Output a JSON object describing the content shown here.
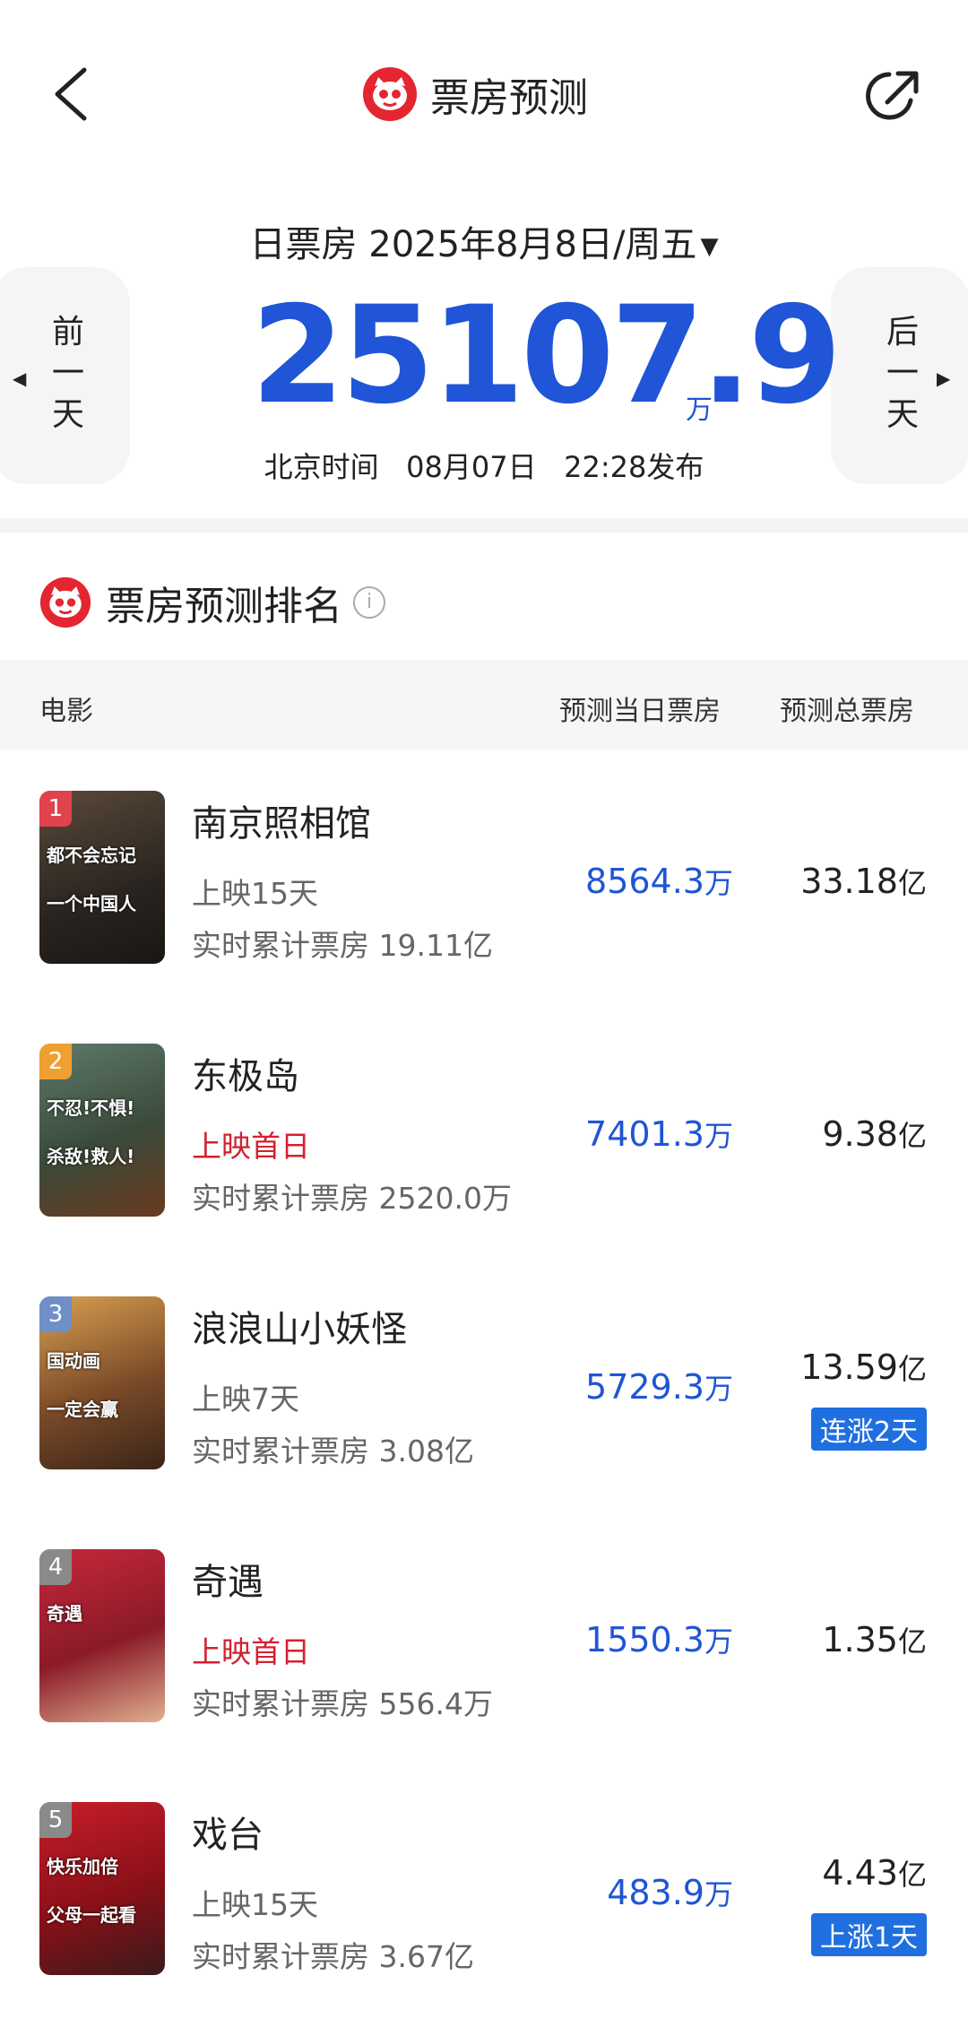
{
  "header": {
    "title": "票房预测"
  },
  "date_selector": {
    "type": "日票房",
    "date": "2025年8月8日/周五"
  },
  "nav": {
    "prev_label": "前一天",
    "next_label": "后一天"
  },
  "total": {
    "value": "25107.9",
    "unit": "万"
  },
  "publish_info": {
    "label": "北京时间",
    "date": "08月07日",
    "time": "22:28发布"
  },
  "section": {
    "title": "票房预测排名"
  },
  "columns": {
    "movie": "电影",
    "daily": "预测当日票房",
    "total": "预测总票房"
  },
  "colors": {
    "accent": "#1f55d6",
    "brand_red": "#e3262f",
    "first_day_red": "#d42030",
    "badge_blue": "#1f6fe0"
  },
  "movies": [
    {
      "rank": "1",
      "title": "南京照相馆",
      "days": "上映15天",
      "cumulative": "实时累计票房 19.11亿",
      "daily": "8564.3",
      "daily_unit": "万",
      "total": "33.18",
      "total_unit": "亿",
      "badge": "",
      "rank_color": "#e0434b",
      "poster_text": [
        "都不会忘记",
        "一个中国人"
      ]
    },
    {
      "rank": "2",
      "title": "东极岛",
      "days": "上映首日",
      "cumulative": "实时累计票房 2520.0万",
      "daily": "7401.3",
      "daily_unit": "万",
      "total": "9.38",
      "total_unit": "亿",
      "badge": "",
      "rank_color": "#f0a030",
      "poster_text": [
        "不忍!不惧!",
        "杀敌!救人!"
      ]
    },
    {
      "rank": "3",
      "title": "浪浪山小妖怪",
      "days": "上映7天",
      "cumulative": "实时累计票房 3.08亿",
      "daily": "5729.3",
      "daily_unit": "万",
      "total": "13.59",
      "total_unit": "亿",
      "badge": "连涨2天",
      "rank_color": "#6f8fc8",
      "poster_text": [
        "国动画",
        "一定会赢"
      ]
    },
    {
      "rank": "4",
      "title": "奇遇",
      "days": "上映首日",
      "cumulative": "实时累计票房 556.4万",
      "daily": "1550.3",
      "daily_unit": "万",
      "total": "1.35",
      "total_unit": "亿",
      "badge": "",
      "rank_color": "#8a8a8a",
      "poster_text": [
        "奇遇"
      ]
    },
    {
      "rank": "5",
      "title": "戏台",
      "days": "上映15天",
      "cumulative": "实时累计票房 3.67亿",
      "daily": "483.9",
      "daily_unit": "万",
      "total": "4.43",
      "total_unit": "亿",
      "badge": "上涨1天",
      "rank_color": "#8a8a8a",
      "poster_text": [
        "快乐加倍",
        "父母一起看"
      ]
    }
  ]
}
